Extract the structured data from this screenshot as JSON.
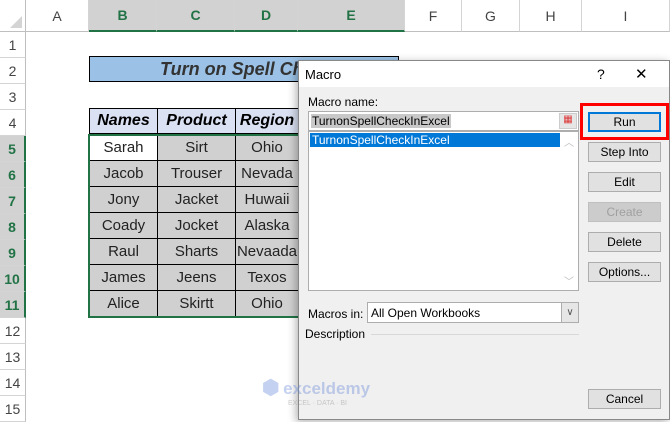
{
  "columns": [
    "A",
    "B",
    "C",
    "D",
    "E",
    "F",
    "G",
    "H",
    "I"
  ],
  "rows": [
    "1",
    "2",
    "3",
    "4",
    "5",
    "6",
    "7",
    "8",
    "9",
    "10",
    "11",
    "12",
    "13",
    "14",
    "15"
  ],
  "title": "Turn on Spell Ch",
  "table": {
    "headers": [
      "Names",
      "Product",
      "Region"
    ],
    "rows": [
      [
        "Sarah",
        "Sirt",
        "Ohio"
      ],
      [
        "Jacob",
        "Trouser",
        "Nevada"
      ],
      [
        "Jony",
        "Jacket",
        "Huwaii"
      ],
      [
        "Coady",
        "Jocket",
        "Alaska"
      ],
      [
        "Raul",
        "Sharts",
        "Nevaada"
      ],
      [
        "James",
        "Jeens",
        "Texos"
      ],
      [
        "Alice",
        "Skirtt",
        "Ohio"
      ]
    ]
  },
  "dialog": {
    "title": "Macro",
    "help": "?",
    "close": "✕",
    "macro_name_label": "Macro name:",
    "macro_name_value": "TurnonSpellCheckInExcel",
    "list": [
      "TurnonSpellCheckInExcel"
    ],
    "buttons": {
      "run": "Run",
      "step_into": "Step Into",
      "edit": "Edit",
      "create": "Create",
      "delete": "Delete",
      "options": "Options...",
      "cancel": "Cancel"
    },
    "macros_in_label": "Macros in:",
    "macros_in_value": "All Open Workbooks",
    "description_label": "Description"
  },
  "watermark": {
    "brand": "exceldemy",
    "tagline": "EXCEL · DATA · BI"
  }
}
